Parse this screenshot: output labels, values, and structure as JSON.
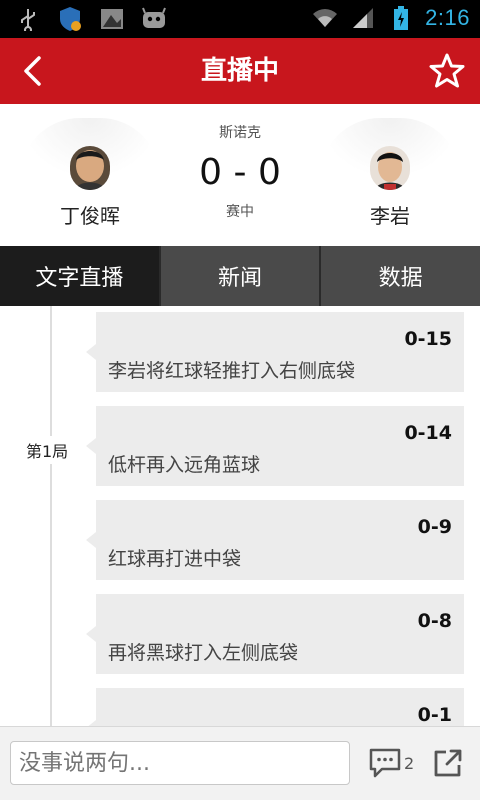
{
  "status_bar": {
    "time": "2:16",
    "icons": [
      "usb-icon",
      "shield-icon",
      "image-icon",
      "android-icon",
      "wifi-icon",
      "signal-icon",
      "battery-icon"
    ]
  },
  "header": {
    "title": "直播中",
    "back_icon": "chevron-left-icon",
    "favorite_icon": "star-icon",
    "background": "#c8161d"
  },
  "match": {
    "event": "斯诺克",
    "score": "0 - 0",
    "status": "赛中",
    "player_left": {
      "name": "丁俊晖"
    },
    "player_right": {
      "name": "李岩"
    }
  },
  "tabs": [
    {
      "label": "文字直播",
      "active": true
    },
    {
      "label": "新闻",
      "active": false
    },
    {
      "label": "数据",
      "active": false
    }
  ],
  "feed": {
    "round_label": "第1局",
    "events": [
      {
        "score": "0-15",
        "text": "李岩将红球轻推打入右侧底袋"
      },
      {
        "score": "0-14",
        "text": "低杆再入远角蓝球"
      },
      {
        "score": "0-9",
        "text": "红球再打进中袋"
      },
      {
        "score": "0-8",
        "text": "再将黑球打入左侧底袋"
      },
      {
        "score": "0-1",
        "text": ""
      }
    ]
  },
  "bottom_bar": {
    "comment_placeholder": "没事说两句...",
    "comment_count": "2",
    "comment_icon": "comment-icon",
    "share_icon": "share-icon"
  }
}
